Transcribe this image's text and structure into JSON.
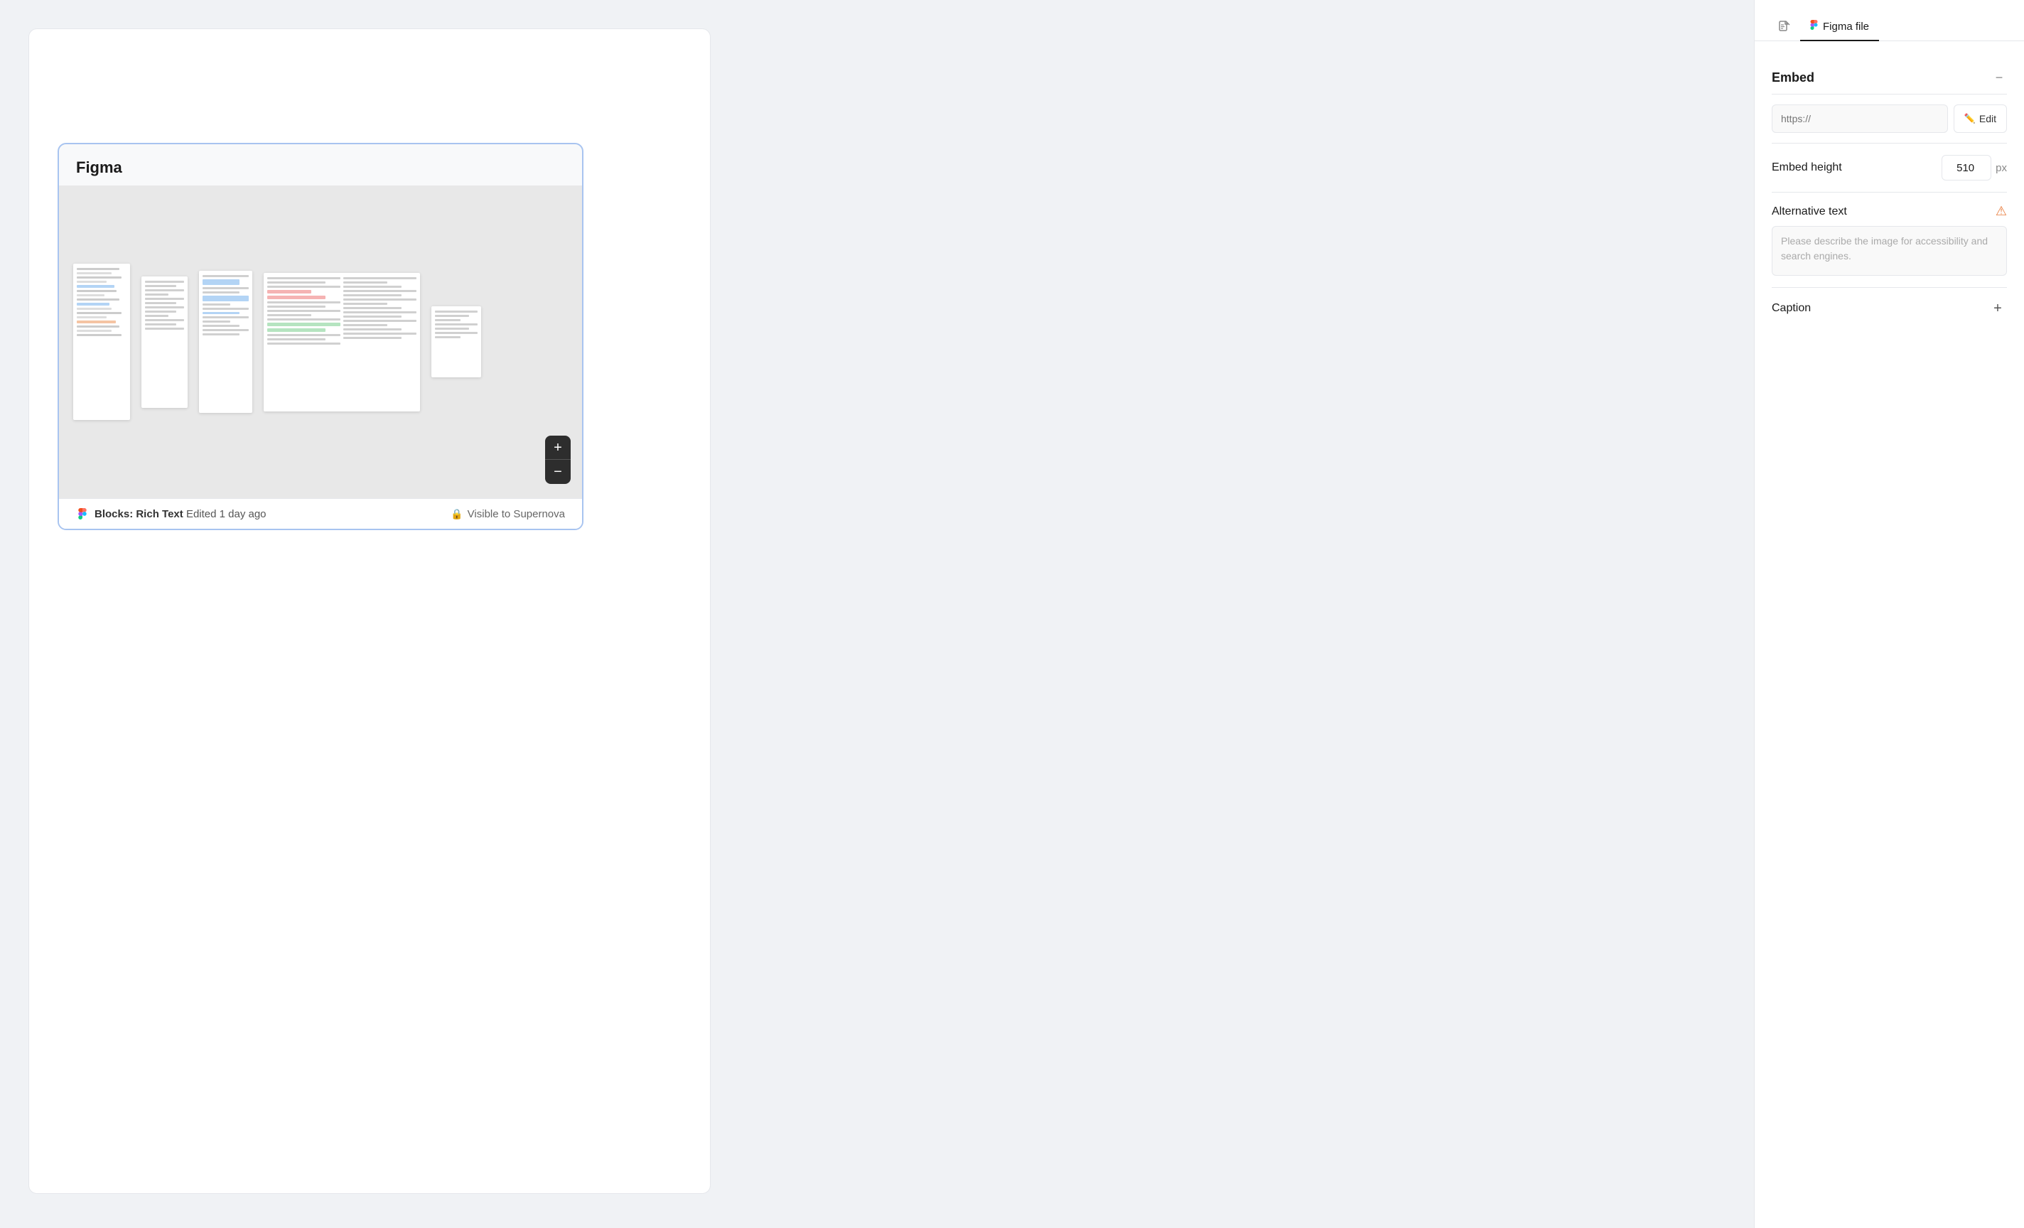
{
  "page": {
    "background": "#f0f2f5"
  },
  "tabs": [
    {
      "id": "file-icon",
      "label": "",
      "icon": "document-icon",
      "active": false
    },
    {
      "id": "figma-file",
      "label": "Figma file",
      "icon": "figma-icon",
      "active": true
    }
  ],
  "panel": {
    "embed_section": {
      "title": "Embed",
      "url_placeholder": "https://",
      "edit_button": "Edit",
      "collapse_icon": "−"
    },
    "embed_height": {
      "label": "Embed height",
      "value": "510",
      "unit": "px"
    },
    "alternative_text": {
      "label": "Alternative text",
      "placeholder": "Please describe the image for accessibility and search engines.",
      "warning": true
    },
    "caption": {
      "label": "Caption",
      "add_icon": "+"
    }
  },
  "figma_block": {
    "title": "Figma",
    "footer_left_prefix": "Blocks: Rich Text",
    "footer_left_suffix": "Edited 1 day ago",
    "footer_right": "Visible to Supernova",
    "zoom_plus": "+",
    "zoom_minus": "−"
  }
}
